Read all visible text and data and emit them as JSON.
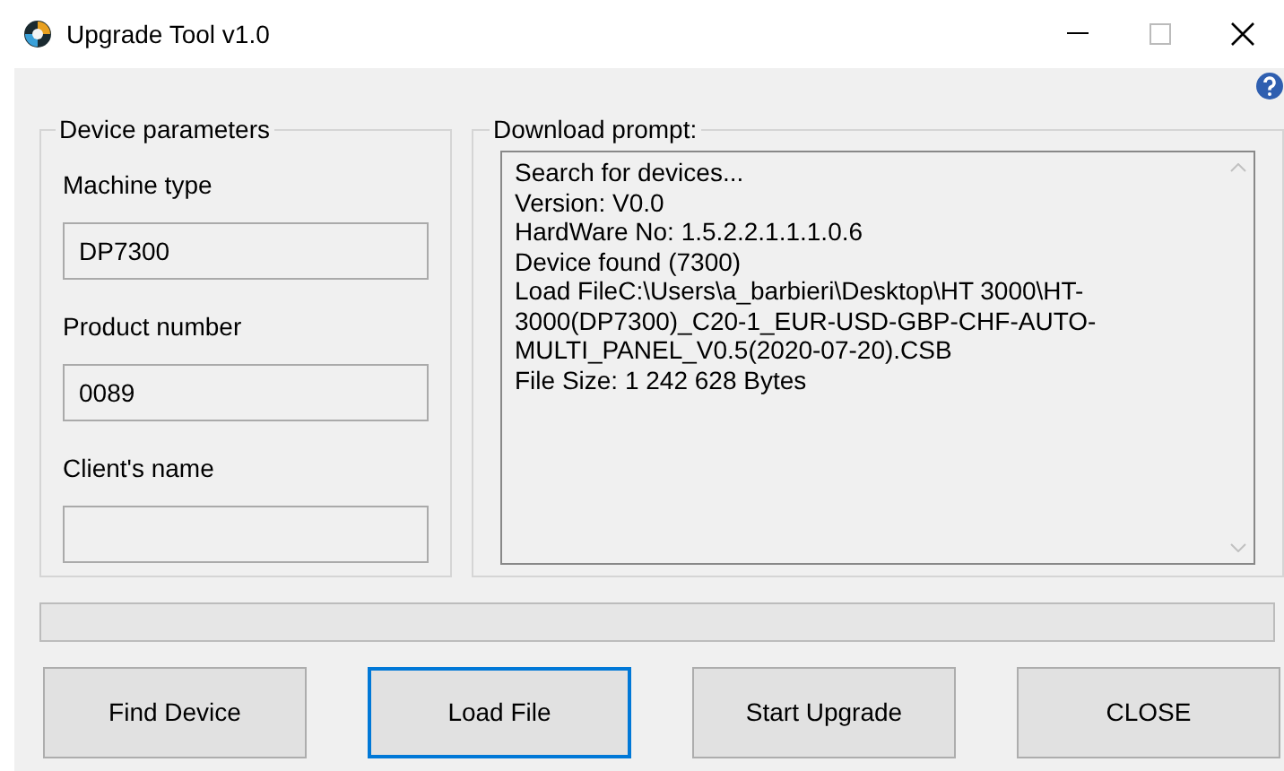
{
  "window": {
    "title": "Upgrade Tool v1.0"
  },
  "device_parameters": {
    "title": "Device parameters",
    "fields": [
      {
        "label": "Machine type",
        "value": "DP7300"
      },
      {
        "label": "Product number",
        "value": "0089"
      },
      {
        "label": "Client's name"
      }
    ]
  },
  "download_prompt": {
    "title": "Download prompt:",
    "lines": [
      "Search for devices...",
      "Version: V0.0",
      "HardWare No: 1.5.2.2.1.1.1.0.6",
      "Device found (7300)",
      "Load FileC:\\Users\\a_barbieri\\Desktop\\HT 3000\\HT-3000(DP7300)_C20-1_EUR-USD-GBP-CHF-AUTO-MULTI_PANEL_V0.5(2020-07-20).CSB",
      "File Size: 1 242 628 Bytes"
    ]
  },
  "buttons": [
    {
      "label": "Find Device",
      "focused": false
    },
    {
      "label": "Load File",
      "focused": true
    },
    {
      "label": "Start Upgrade",
      "focused": false
    },
    {
      "label": "CLOSE",
      "focused": false
    }
  ]
}
